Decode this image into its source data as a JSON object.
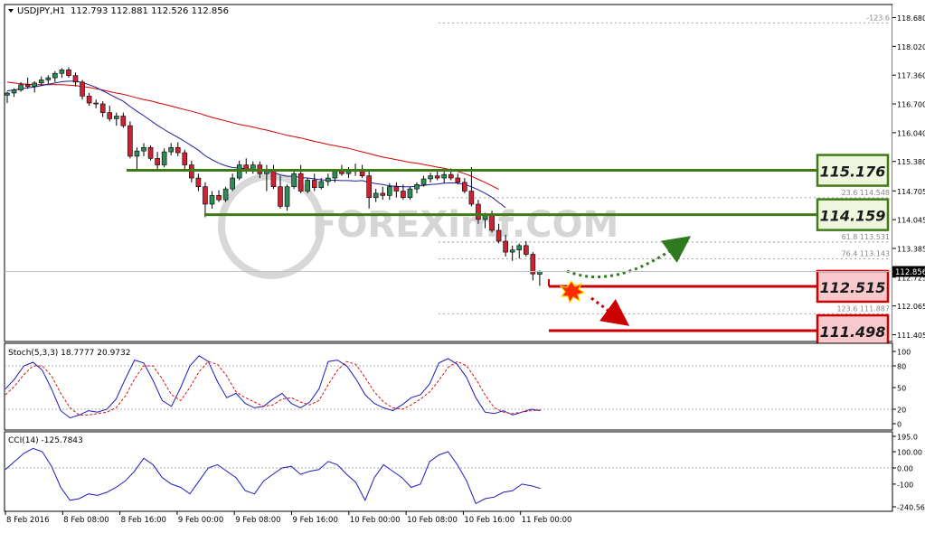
{
  "chart_data": {
    "type": "candlestick",
    "header": {
      "symbol_tf": "USDJPY,H1",
      "ohlc": "112.793 112.881 112.526 112.856"
    },
    "watermark": "FOREXimf.COM",
    "price_axis": {
      "ticks": [
        "118.680",
        "118.020",
        "117.360",
        "116.700",
        "116.040",
        "115.380",
        "114.705",
        "114.045",
        "113.385",
        "112.725",
        "112.065",
        "111.405"
      ],
      "tick_values": [
        118.68,
        118.02,
        117.36,
        116.7,
        116.04,
        115.38,
        114.705,
        114.045,
        113.385,
        112.725,
        112.065,
        111.405
      ],
      "ylim": [
        111.25,
        118.98
      ],
      "current_price": "112.856",
      "current_value": 112.856
    },
    "time_axis": {
      "labels": [
        "8 Feb 2016",
        "8 Feb 08:00",
        "8 Feb 16:00",
        "9 Feb 00:00",
        "9 Feb 08:00",
        "9 Feb 16:00",
        "10 Feb 00:00",
        "10 Feb 08:00",
        "10 Feb 16:00",
        "11 Feb 00:00"
      ]
    },
    "candles": [
      [
        116.9,
        116.98,
        116.72,
        116.95
      ],
      [
        116.95,
        117.06,
        116.86,
        117.02
      ],
      [
        117.02,
        117.2,
        116.98,
        117.14
      ],
      [
        117.14,
        117.3,
        117.05,
        117.1
      ],
      [
        117.1,
        117.22,
        116.96,
        117.18
      ],
      [
        117.18,
        117.33,
        117.12,
        117.25
      ],
      [
        117.25,
        117.36,
        117.16,
        117.3
      ],
      [
        117.3,
        117.45,
        117.2,
        117.4
      ],
      [
        117.4,
        117.52,
        117.3,
        117.48
      ],
      [
        117.48,
        117.54,
        117.3,
        117.35
      ],
      [
        117.35,
        117.42,
        117.1,
        117.2
      ],
      [
        117.2,
        117.25,
        116.8,
        116.88
      ],
      [
        116.88,
        116.95,
        116.66,
        116.72
      ],
      [
        116.72,
        116.8,
        116.6,
        116.7
      ],
      [
        116.7,
        116.76,
        116.4,
        116.5
      ],
      [
        116.5,
        116.66,
        116.3,
        116.36
      ],
      [
        116.36,
        116.5,
        116.2,
        116.42
      ],
      [
        116.42,
        116.5,
        116.15,
        116.2
      ],
      [
        116.2,
        116.3,
        115.45,
        115.5
      ],
      [
        115.5,
        115.7,
        115.2,
        115.62
      ],
      [
        115.62,
        115.8,
        115.5,
        115.7
      ],
      [
        115.7,
        115.75,
        115.4,
        115.45
      ],
      [
        115.45,
        115.6,
        115.2,
        115.3
      ],
      [
        115.3,
        115.68,
        115.25,
        115.6
      ],
      [
        115.6,
        115.8,
        115.52,
        115.7
      ],
      [
        115.7,
        115.82,
        115.5,
        115.58
      ],
      [
        115.58,
        115.65,
        115.2,
        115.3
      ],
      [
        115.3,
        115.4,
        114.9,
        115.0
      ],
      [
        115.0,
        115.1,
        114.7,
        114.8
      ],
      [
        114.8,
        114.9,
        114.1,
        114.4
      ],
      [
        114.4,
        114.7,
        114.3,
        114.6
      ],
      [
        114.6,
        114.72,
        114.45,
        114.5
      ],
      [
        114.5,
        114.8,
        114.45,
        114.75
      ],
      [
        114.75,
        115.1,
        114.7,
        115.0
      ],
      [
        115.0,
        115.4,
        114.95,
        115.3
      ],
      [
        115.3,
        115.45,
        115.1,
        115.2
      ],
      [
        115.2,
        115.38,
        115.1,
        115.3
      ],
      [
        115.3,
        115.38,
        115.0,
        115.1
      ],
      [
        115.1,
        115.3,
        114.7,
        115.2
      ],
      [
        115.2,
        115.3,
        114.75,
        114.8
      ],
      [
        114.8,
        115.05,
        114.3,
        114.35
      ],
      [
        114.35,
        114.85,
        114.25,
        114.8
      ],
      [
        114.8,
        115.2,
        114.75,
        115.1
      ],
      [
        115.1,
        115.3,
        114.65,
        114.7
      ],
      [
        114.7,
        115.0,
        114.65,
        114.95
      ],
      [
        114.95,
        115.1,
        114.7,
        114.78
      ],
      [
        114.78,
        115.0,
        114.74,
        114.92
      ],
      [
        114.92,
        115.1,
        114.82,
        115.0
      ],
      [
        115.0,
        115.2,
        114.9,
        115.15
      ],
      [
        115.15,
        115.3,
        115.05,
        115.1
      ],
      [
        115.1,
        115.25,
        115.0,
        115.2
      ],
      [
        115.2,
        115.33,
        115.05,
        115.15
      ],
      [
        115.15,
        115.3,
        115.0,
        115.05
      ],
      [
        115.05,
        115.2,
        114.3,
        114.55
      ],
      [
        114.55,
        114.75,
        114.45,
        114.65
      ],
      [
        114.65,
        114.8,
        114.5,
        114.6
      ],
      [
        114.6,
        114.88,
        114.5,
        114.8
      ],
      [
        114.8,
        114.9,
        114.55,
        114.7
      ],
      [
        114.7,
        114.85,
        114.5,
        114.55
      ],
      [
        114.55,
        114.8,
        114.5,
        114.75
      ],
      [
        114.75,
        114.9,
        114.65,
        114.85
      ],
      [
        114.85,
        115.05,
        114.8,
        114.98
      ],
      [
        114.98,
        115.12,
        114.9,
        115.05
      ],
      [
        115.05,
        115.18,
        114.95,
        115.0
      ],
      [
        115.0,
        115.15,
        114.88,
        115.08
      ],
      [
        115.08,
        115.22,
        114.95,
        115.0
      ],
      [
        115.0,
        115.1,
        114.85,
        114.9
      ],
      [
        114.9,
        115.0,
        114.65,
        114.7
      ],
      [
        114.7,
        115.25,
        114.35,
        114.4
      ],
      [
        114.4,
        114.5,
        113.95,
        114.05
      ],
      [
        114.05,
        114.2,
        113.85,
        114.15
      ],
      [
        114.15,
        114.25,
        113.75,
        113.8
      ],
      [
        113.8,
        113.95,
        113.5,
        113.55
      ],
      [
        113.55,
        113.7,
        113.2,
        113.3
      ],
      [
        113.3,
        113.45,
        113.1,
        113.35
      ],
      [
        113.35,
        113.5,
        113.15,
        113.45
      ],
      [
        113.45,
        113.55,
        113.2,
        113.25
      ],
      [
        113.25,
        113.3,
        112.65,
        112.8
      ],
      [
        112.793,
        112.881,
        112.526,
        112.856
      ]
    ],
    "moving_averages": [
      {
        "color": "#d40000",
        "values": [
          117.2,
          117.18,
          117.16,
          117.15,
          117.14,
          117.14,
          117.14,
          117.14,
          117.14,
          117.13,
          117.12,
          117.1,
          117.08,
          117.05,
          117.02,
          116.98,
          116.95,
          116.92,
          116.88,
          116.84,
          116.8,
          116.77,
          116.73,
          116.69,
          116.65,
          116.61,
          116.57,
          116.53,
          116.49,
          116.44,
          116.39,
          116.35,
          116.31,
          116.27,
          116.23,
          116.2,
          116.17,
          116.13,
          116.1,
          116.06,
          116.02,
          115.98,
          115.95,
          115.92,
          115.88,
          115.84,
          115.81,
          115.77,
          115.74,
          115.71,
          115.68,
          115.64,
          115.6,
          115.56,
          115.52,
          115.48,
          115.45,
          115.42,
          115.39,
          115.36,
          115.34,
          115.31,
          115.28,
          115.25,
          115.22,
          115.19,
          115.15,
          115.1,
          115.04,
          114.97,
          114.9,
          114.82,
          114.74
        ]
      },
      {
        "color": "#1c1c9e",
        "values": [
          117.0,
          117.02,
          117.05,
          117.07,
          117.09,
          117.12,
          117.15,
          117.18,
          117.21,
          117.22,
          117.22,
          117.19,
          117.14,
          117.08,
          117.0,
          116.92,
          116.84,
          116.76,
          116.64,
          116.53,
          116.43,
          116.32,
          116.21,
          116.11,
          116.02,
          115.93,
          115.84,
          115.74,
          115.64,
          115.51,
          115.42,
          115.34,
          115.28,
          115.24,
          115.23,
          115.21,
          115.2,
          115.17,
          115.16,
          115.13,
          115.07,
          115.04,
          115.04,
          115.01,
          115.0,
          114.98,
          114.96,
          114.95,
          114.95,
          114.94,
          114.94,
          114.93,
          114.94,
          114.9,
          114.87,
          114.85,
          114.82,
          114.81,
          114.8,
          114.8,
          114.81,
          114.83,
          114.85,
          114.86,
          114.88,
          114.89,
          114.88,
          114.85,
          114.8,
          114.73,
          114.65,
          114.56,
          114.44,
          114.32
        ]
      }
    ],
    "support_resistance": [
      {
        "label": "115.176",
        "value": 115.176,
        "type": "resistance",
        "box_color": "#eef7dd",
        "line_color": "#3f7a17"
      },
      {
        "label": "114.159",
        "value": 114.159,
        "type": "resistance",
        "box_color": "#eef7dd",
        "line_color": "#3f7a17"
      },
      {
        "label": "112.515",
        "value": 112.515,
        "type": "support",
        "box_color": "#f7c8cc",
        "line_color": "#cc0000"
      },
      {
        "label": "111.498",
        "value": 111.498,
        "type": "support",
        "box_color": "#f7c8cc",
        "line_color": "#cc0000"
      }
    ],
    "fibonacci": [
      {
        "label": "-123.6",
        "value": 118.56
      },
      {
        "label": "23.6  114.548",
        "value": 114.548
      },
      {
        "label": "61.8  113.531",
        "value": 113.531
      },
      {
        "label": "76.4  113.143",
        "value": 113.143
      },
      {
        "label": "123.6  111.887",
        "value": 111.887
      }
    ],
    "stochastic": {
      "label": "Stoch(5,3,3) 18.7777 20.9732",
      "ticks": [
        "100",
        "80",
        "50",
        "20",
        "0"
      ],
      "tick_values": [
        100,
        80,
        50,
        20,
        0
      ],
      "k": [
        48,
        62,
        80,
        85,
        74,
        48,
        18,
        8,
        12,
        18,
        16,
        20,
        34,
        62,
        88,
        84,
        60,
        32,
        24,
        50,
        80,
        94,
        86,
        58,
        36,
        42,
        28,
        22,
        24,
        34,
        42,
        28,
        22,
        30,
        48,
        86,
        88,
        80,
        62,
        40,
        28,
        22,
        18,
        26,
        36,
        40,
        55,
        84,
        90,
        82,
        64,
        36,
        16,
        14,
        18,
        12,
        16,
        20,
        18
      ],
      "d": [
        40,
        52,
        68,
        80,
        80,
        66,
        42,
        22,
        12,
        12,
        14,
        16,
        22,
        38,
        62,
        80,
        80,
        62,
        40,
        32,
        50,
        72,
        86,
        82,
        66,
        44,
        36,
        30,
        24,
        26,
        34,
        36,
        30,
        26,
        32,
        54,
        74,
        86,
        82,
        64,
        44,
        30,
        22,
        20,
        26,
        34,
        44,
        60,
        78,
        86,
        80,
        62,
        40,
        22,
        16,
        14,
        16,
        18,
        19
      ]
    },
    "cci": {
      "label": "CCI(14) -125.7843",
      "ticks": [
        "195.0",
        "100.00",
        "0.00",
        "-100",
        "-240.56"
      ],
      "tick_values": [
        195,
        100,
        0,
        -100,
        -240
      ],
      "values": [
        -10,
        40,
        90,
        120,
        100,
        10,
        -120,
        -200,
        -190,
        -160,
        -170,
        -150,
        -120,
        -80,
        -20,
        60,
        20,
        -60,
        -100,
        -120,
        -160,
        -80,
        0,
        20,
        -20,
        -60,
        -140,
        -160,
        -80,
        -40,
        0,
        10,
        -40,
        -20,
        -10,
        40,
        20,
        -40,
        -90,
        -200,
        -60,
        20,
        -20,
        -60,
        -120,
        -100,
        40,
        80,
        100,
        20,
        -80,
        -220,
        -190,
        -180,
        -150,
        -140,
        -100,
        -110,
        -126
      ]
    }
  }
}
